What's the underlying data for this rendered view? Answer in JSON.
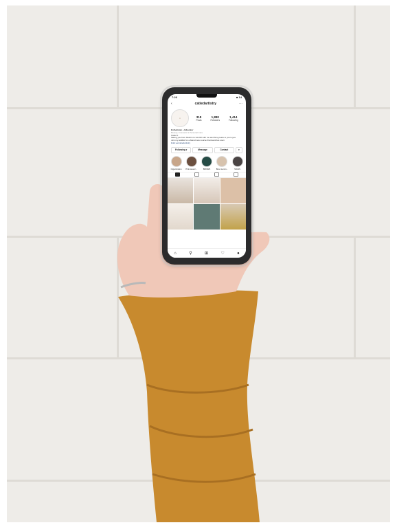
{
  "phone": {
    "status_time": "7:26",
    "status_right": "■ 14",
    "username": "catiedartistry",
    "back_icon": "back-chevron-icon",
    "stats": [
      {
        "value": "318",
        "label": "Posts"
      },
      {
        "value": "1,880",
        "label": "Followers"
      },
      {
        "value": "1,414",
        "label": "Following"
      }
    ],
    "bio": {
      "name": "Esthetician + Educator",
      "category": "Beauty, Cosmetic & Personal Care",
      "lines": [
        "Catie D.",
        "Taking you from blushin to GLOW with me and bring tears to your eyes",
        "Join my waitlist for a brand new course that launches soon"
      ],
      "link": "linktr.ee/catiedartistry"
    },
    "buttons": [
      "Following ▾",
      "Message",
      "Contact",
      "▾"
    ],
    "highlights": [
      {
        "label": "Organization",
        "color": "#c8a68a"
      },
      {
        "label": "Pink tweetz...",
        "color": "#6b4f3f"
      },
      {
        "label": "BROWS",
        "color": "#254b45"
      },
      {
        "label": "Brow Lamin...",
        "color": "#d7c3ae"
      },
      {
        "label": "SIGNS",
        "color": "#4a4444"
      }
    ]
  },
  "colors": {
    "wall": "#eeece8",
    "sleeve": "#c88a2e",
    "skin": "#f0c8b8"
  }
}
